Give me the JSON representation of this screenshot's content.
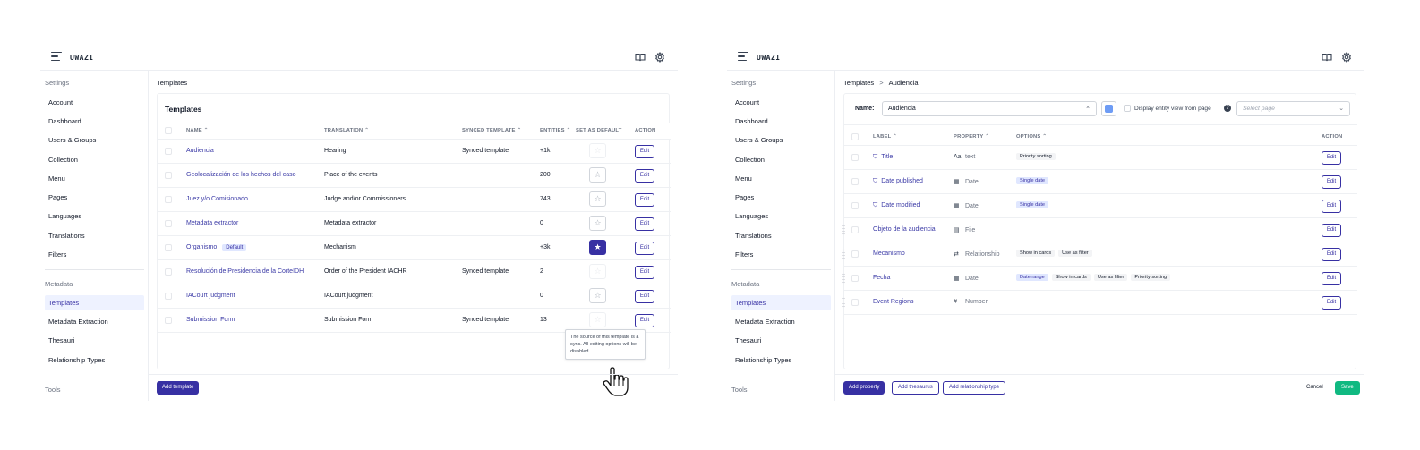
{
  "brand": "UWAZI",
  "sidebar": {
    "settings_label": "Settings",
    "settings_items": [
      "Account",
      "Dashboard",
      "Users & Groups",
      "Collection",
      "Menu",
      "Pages",
      "Languages",
      "Translations",
      "Filters"
    ],
    "metadata_label": "Metadata",
    "metadata_items": [
      "Templates",
      "Metadata Extraction",
      "Thesauri",
      "Relationship Types"
    ],
    "tools_label": "Tools"
  },
  "left": {
    "breadcrumb": "Templates",
    "card_title": "Templates",
    "headers": {
      "name": "NAME",
      "translation": "TRANSLATION",
      "synced": "SYNCED TEMPLATE",
      "entities": "ENTITIES",
      "default": "SET AS DEFAULT",
      "action": "ACTION"
    },
    "rows": [
      {
        "name": "Audiencia",
        "translation": "Hearing",
        "synced": "Synced template",
        "entities": "+1k",
        "default": false,
        "badge": "",
        "edit": "Edit"
      },
      {
        "name": "Geolocalización de los hechos del caso",
        "translation": "Place of the events",
        "synced": "",
        "entities": "200",
        "default": false,
        "badge": "",
        "edit": "Edit"
      },
      {
        "name": "Juez y/o Comisionado",
        "translation": "Judge and/or Commissioners",
        "synced": "",
        "entities": "743",
        "default": false,
        "badge": "",
        "edit": "Edit"
      },
      {
        "name": "Metadata extractor",
        "translation": "Metadata extractor",
        "synced": "",
        "entities": "0",
        "default": false,
        "badge": "",
        "edit": "Edit"
      },
      {
        "name": "Organismo",
        "translation": "Mechanism",
        "synced": "",
        "entities": "+3k",
        "default": true,
        "badge": "Default",
        "edit": "Edit"
      },
      {
        "name": "Resolución de Presidencia de la CorteIDH",
        "translation": "Order of the President IACHR",
        "synced": "Synced template",
        "entities": "2",
        "default": false,
        "badge": "",
        "edit": "Edit"
      },
      {
        "name": "IACourt judgment",
        "translation": "IACourt judgment",
        "synced": "",
        "entities": "0",
        "default": false,
        "badge": "",
        "edit": "Edit"
      },
      {
        "name": "Submission Form",
        "translation": "Submission Form",
        "synced": "Synced template",
        "entities": "13",
        "default": false,
        "badge": "",
        "edit": "Edit"
      }
    ],
    "tooltip": "The source of this template is a sync. All editing options will be disabled.",
    "add_button": "Add template"
  },
  "right": {
    "breadcrumb_parent": "Templates",
    "breadcrumb_sep": ">",
    "breadcrumb_current": "Audiencia",
    "name_label": "Name:",
    "name_value": "Audiencia",
    "clear_glyph": "×",
    "display_label": "Display entity view from page",
    "help_glyph": "?",
    "page_placeholder": "Select page",
    "headers": {
      "label": "LABEL",
      "property": "PROPERTY",
      "options": "OPTIONS",
      "action": "ACTION"
    },
    "rows": [
      {
        "label": "Title",
        "locked": true,
        "draggable": false,
        "icon": "Aa",
        "icon_name": "text-icon",
        "property": "text",
        "options": [
          {
            "text": "Priority sorting",
            "style": "gray"
          }
        ],
        "edit": "Edit"
      },
      {
        "label": "Date published",
        "locked": true,
        "draggable": false,
        "icon": "▦",
        "icon_name": "calendar-icon",
        "property": "Date",
        "options": [
          {
            "text": "Single date",
            "style": "blue"
          }
        ],
        "edit": "Edit"
      },
      {
        "label": "Date modified",
        "locked": true,
        "draggable": false,
        "icon": "▦",
        "icon_name": "calendar-icon",
        "property": "Date",
        "options": [
          {
            "text": "Single date",
            "style": "blue"
          }
        ],
        "edit": "Edit"
      },
      {
        "label": "Objeto de la audiencia",
        "locked": false,
        "draggable": true,
        "icon": "▤",
        "icon_name": "file-icon",
        "property": "File",
        "options": [],
        "edit": "Edit"
      },
      {
        "label": "Mecanismo",
        "locked": false,
        "draggable": true,
        "icon": "⇄",
        "icon_name": "relationship-icon",
        "property": "Relationship",
        "options": [
          {
            "text": "Show in cards",
            "style": "gray"
          },
          {
            "text": "Use as filter",
            "style": "gray"
          }
        ],
        "edit": "Edit"
      },
      {
        "label": "Fecha",
        "locked": false,
        "draggable": true,
        "icon": "▦",
        "icon_name": "calendar-icon",
        "property": "Date",
        "options": [
          {
            "text": "Date range",
            "style": "blue"
          },
          {
            "text": "Show in cards",
            "style": "gray"
          },
          {
            "text": "Use as filter",
            "style": "gray"
          },
          {
            "text": "Priority sorting",
            "style": "gray"
          }
        ],
        "edit": "Edit"
      },
      {
        "label": "Event Regions",
        "locked": false,
        "draggable": true,
        "icon": "#",
        "icon_name": "hash-icon",
        "property": "Number",
        "options": [],
        "edit": "Edit"
      }
    ],
    "buttons": {
      "add_property": "Add property",
      "add_thesaurus": "Add thesaurus",
      "add_relationship": "Add relationship type",
      "cancel": "Cancel",
      "save": "Save"
    }
  },
  "colors": {
    "accent": "#3730a3",
    "save": "#10b981",
    "template_color": "#6e9cf5"
  }
}
